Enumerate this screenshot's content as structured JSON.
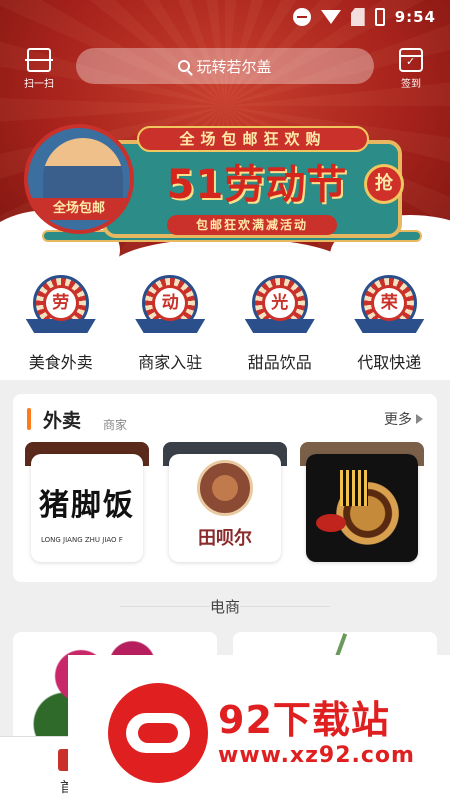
{
  "status_bar": {
    "time": "9:54"
  },
  "header": {
    "scan_label": "扫一扫",
    "search_placeholder": "玩转若尔盖",
    "signin_label": "签到"
  },
  "banner": {
    "ribbon": "全场包邮狂欢购",
    "title": "51劳动节",
    "subtitle": "包邮狂欢满减活动",
    "badge_left": "全场包邮",
    "grab_button": "抢"
  },
  "categories": [
    {
      "char": "劳",
      "label": "美食外卖"
    },
    {
      "char": "动",
      "label": "商家入驻"
    },
    {
      "char": "光",
      "label": "甜品饮品"
    },
    {
      "char": "荣",
      "label": "代取快递"
    }
  ],
  "takeout": {
    "title": "外卖",
    "subtitle": "商家",
    "more": "更多",
    "shops": [
      {
        "name": "猪脚饭",
        "name_en": "LONG JIANG ZHU JIAO F"
      },
      {
        "name": "田呗尔"
      },
      {
        "name": ""
      }
    ]
  },
  "ecommerce": {
    "title": "电商"
  },
  "bottom_nav": {
    "first_label": "首"
  },
  "watermark": {
    "text": "92下载站",
    "url": "www.xz92.com"
  },
  "colors": {
    "brand_red": "#c9312a",
    "accent_orange": "#ff7a1a",
    "banner_teal": "#2c8c87"
  }
}
